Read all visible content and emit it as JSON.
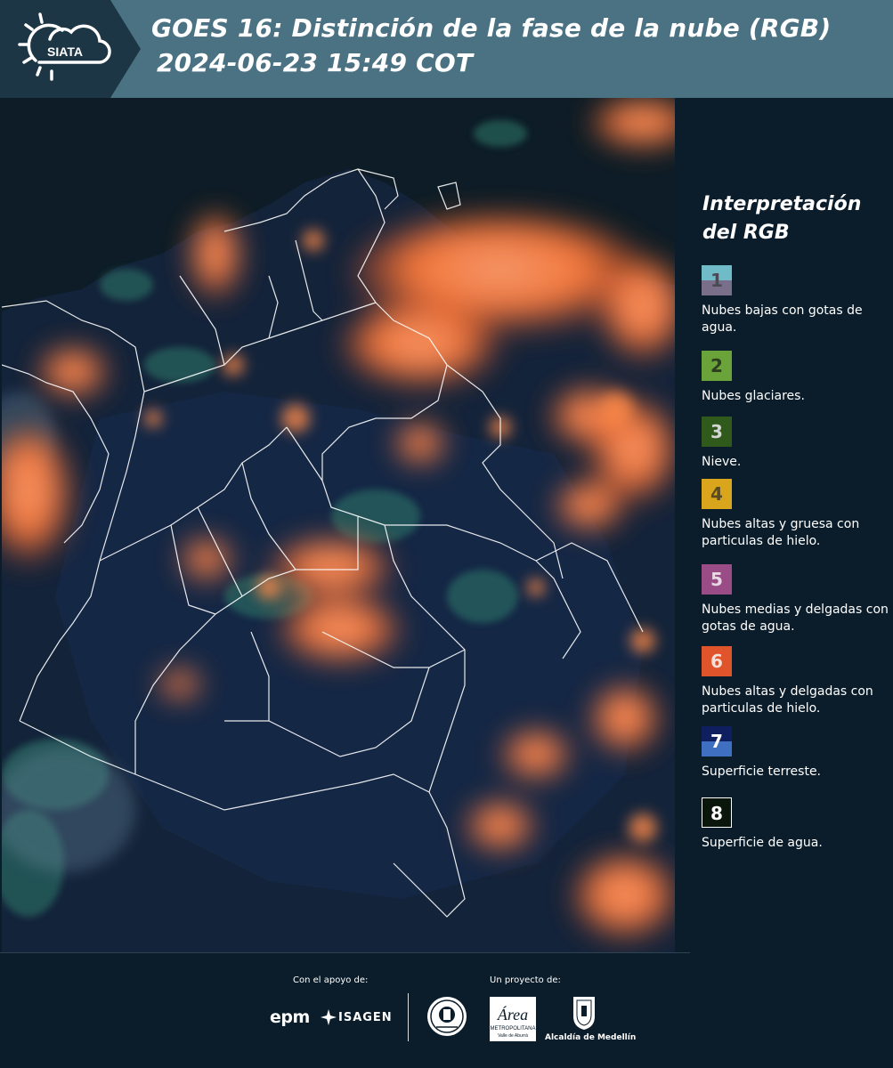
{
  "header": {
    "logo_text": "SIATA",
    "title_line1": "GOES 16: Distinción de la fase de la nube (RGB)",
    "title_line2": "2024-06-23 15:49 COT"
  },
  "legend": {
    "title_line1": "Interpretación",
    "title_line2": "del RGB",
    "items": [
      {
        "number": "1",
        "label": "Nubes bajas con gotas de agua.",
        "color_top": "#6fbcc8",
        "color_bottom": "#7a6f8a",
        "text_color": "#4a4a55"
      },
      {
        "number": "2",
        "label": "Nubes glaciares.",
        "color_top": "#6aa33a",
        "color_bottom": "#6aa33a",
        "text_color": "#2c3e20"
      },
      {
        "number": "3",
        "label": "Nieve.",
        "color_top": "#2f5a1c",
        "color_bottom": "#2f5a1c",
        "text_color": "#d5d5d5"
      },
      {
        "number": "4",
        "label": "Nubes altas y gruesa con particulas de hielo.",
        "color_top": "#d9a51c",
        "color_bottom": "#d9a51c",
        "text_color": "#5a4a20"
      },
      {
        "number": "5",
        "label": "Nubes medias y delgadas con gotas de agua.",
        "color_top": "#9a4c86",
        "color_bottom": "#9a4c86",
        "text_color": "#e8d8e4"
      },
      {
        "number": "6",
        "label": "Nubes altas y delgadas con particulas de hielo.",
        "color_top": "#e0542c",
        "color_bottom": "#e0542c",
        "text_color": "#f6e0d8"
      },
      {
        "number": "7",
        "label": "Superficie terreste.",
        "color_top": "#0e1e5e",
        "color_bottom": "#3f6fc0",
        "text_color": "#ffffff"
      },
      {
        "number": "8",
        "label": "Superficie de agua.",
        "color_top": "#0a160c",
        "color_bottom": "#0a160c",
        "text_color": "#ffffff"
      }
    ]
  },
  "footer": {
    "support_label": "Con el apoyo de:",
    "project_label": "Un proyecto de:",
    "epm": "epm",
    "isagen": "ISAGEN",
    "area_name": "Área",
    "area_subtitle": "METROPOLITANA",
    "area_subtitle2": "Valle de Aburrá",
    "alcaldia": "Alcaldía de Medellín"
  },
  "colors": {
    "header_bg": "#4a7282",
    "page_bg": "#0b1d2a",
    "cloud_orange": "#ff7a3a",
    "land": "#14243a",
    "border_lines": "#ffffff"
  }
}
